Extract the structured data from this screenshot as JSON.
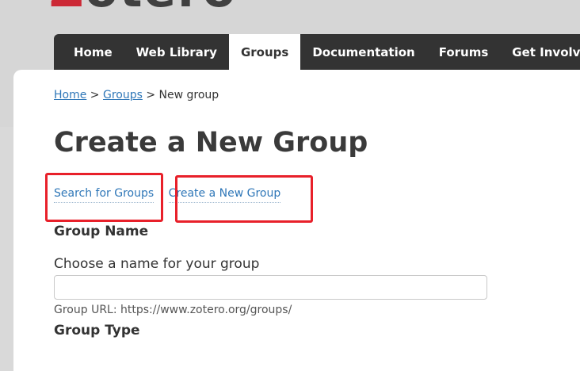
{
  "header": {
    "logo_first_letter": "Z",
    "logo_rest": "otero",
    "nav": [
      "Home",
      "Web Library",
      "Groups",
      "Documentation",
      "Forums",
      "Get Involved"
    ]
  },
  "breadcrumb": {
    "home": "Home",
    "sep1": ">",
    "groups": "Groups",
    "sep2": ">",
    "current": "New group"
  },
  "page": {
    "title": "Create a New Group",
    "tabs": {
      "search": "Search for Groups",
      "separator": "·",
      "create": "Create a New Group"
    }
  },
  "form": {
    "group_name_heading": "Group Name",
    "name_label": "Choose a name for your group",
    "name_value": "",
    "url_hint": "Group URL: https://www.zotero.org/groups/",
    "group_type_heading": "Group Type"
  },
  "colors": {
    "nav_bg": "#333333",
    "link": "#2f77b8",
    "highlight": "#e8202a",
    "logo_accent": "#cc2936"
  }
}
